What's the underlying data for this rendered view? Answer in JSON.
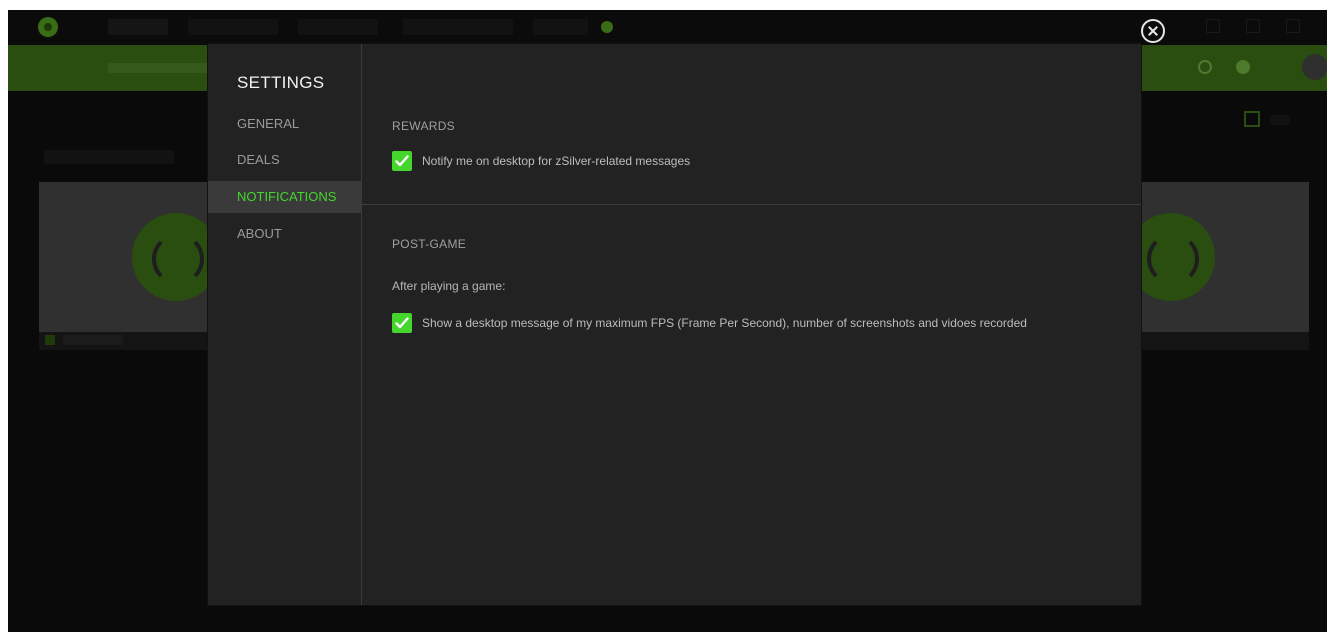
{
  "colors": {
    "accent": "#44d62c",
    "dialog_bg": "#222222",
    "overlay_bg": "#0a0a0a"
  },
  "settings": {
    "title": "SETTINGS",
    "nav": [
      {
        "label": "GENERAL",
        "active": false
      },
      {
        "label": "DEALS",
        "active": false
      },
      {
        "label": "NOTIFICATIONS",
        "active": true
      },
      {
        "label": "ABOUT",
        "active": false
      }
    ]
  },
  "notifications": {
    "rewards": {
      "title": "REWARDS",
      "option_label": "Notify me on desktop for zSilver-related messages",
      "checked": true
    },
    "post_game": {
      "title": "POST-GAME",
      "intro": "After playing a game:",
      "option_label": "Show a desktop message of my maximum FPS (Frame Per Second), number of screenshots and vidoes recorded",
      "checked": true
    }
  },
  "icons": {
    "close": "close-circle-icon",
    "check": "checkmark-icon"
  }
}
